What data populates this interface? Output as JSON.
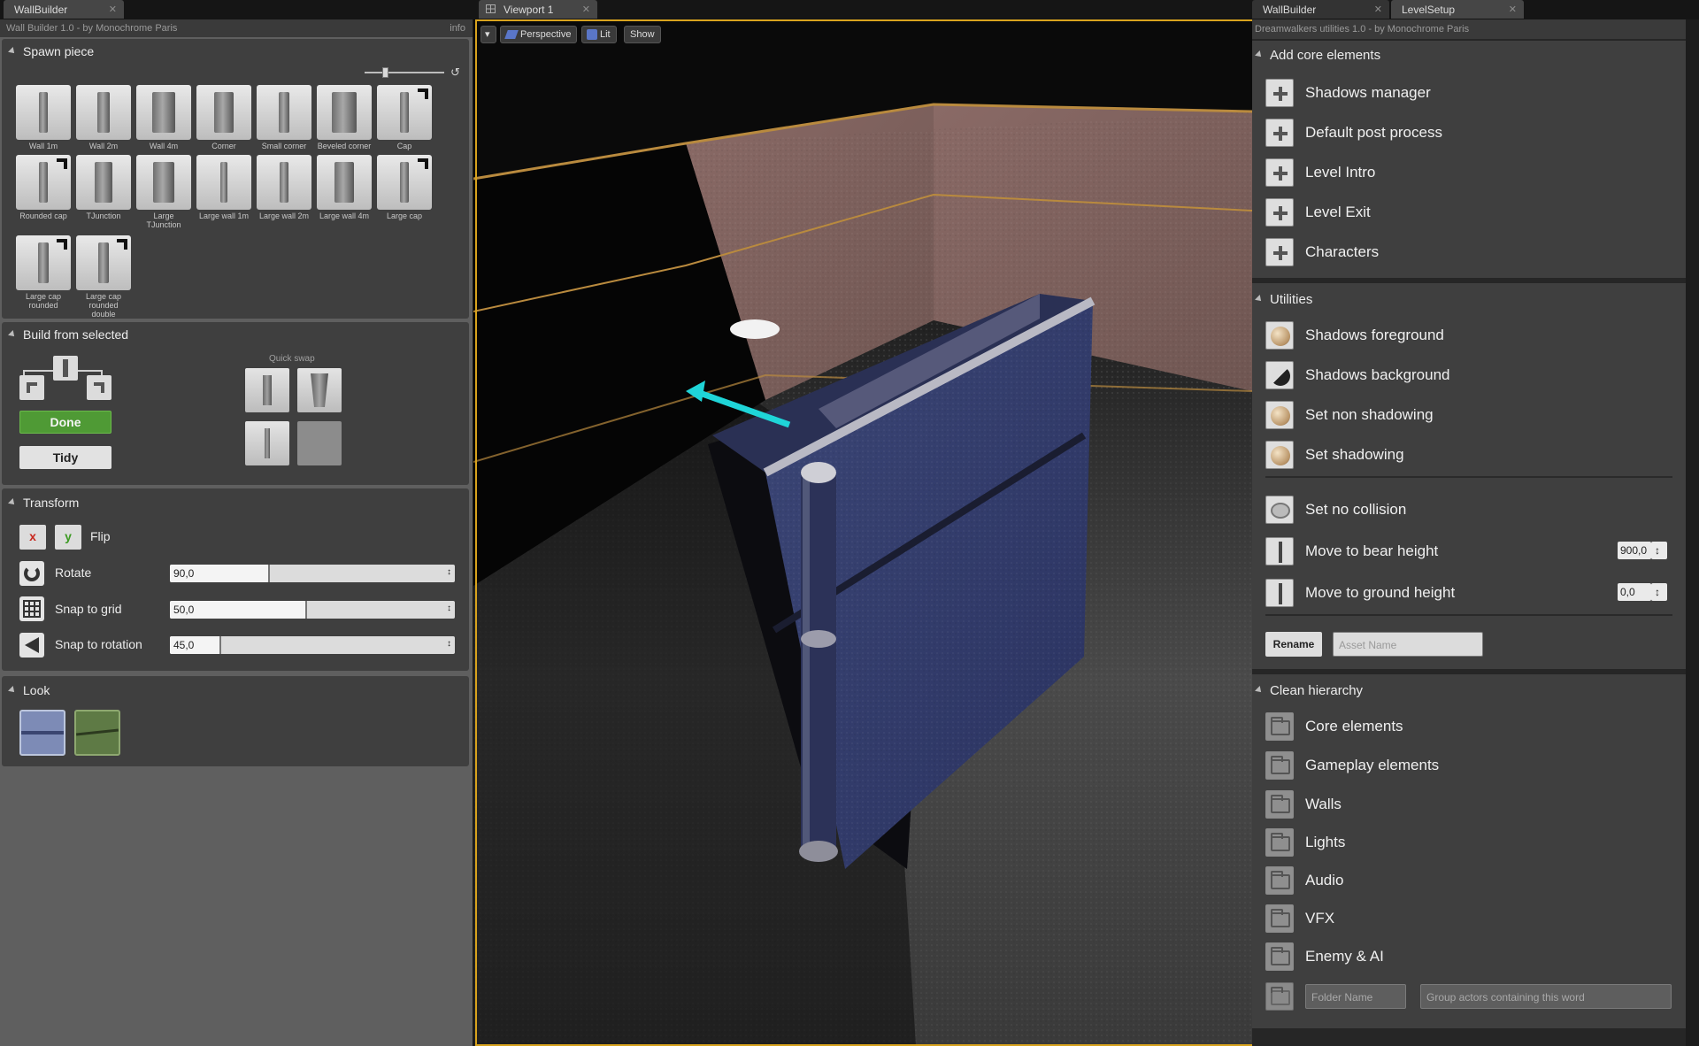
{
  "left_panel": {
    "tab": "WallBuilder",
    "subtitle": "Wall Builder 1.0 - by Monochrome Paris",
    "info": "info",
    "spawn": {
      "title": "Spawn piece",
      "pieces": [
        "Wall 1m",
        "Wall 2m",
        "Wall 4m",
        "Corner",
        "Small corner",
        "Beveled corner",
        "Cap",
        "Rounded cap",
        "TJunction",
        "Large TJunction",
        "Large wall 1m",
        "Large wall 2m",
        "Large wall 4m",
        "Large cap",
        "Large cap rounded",
        "Large cap rounded double"
      ]
    },
    "build": {
      "title": "Build from selected",
      "quick_swap": "Quick swap",
      "done": "Done",
      "tidy": "Tidy"
    },
    "transform": {
      "title": "Transform",
      "x": "x",
      "y": "y",
      "flip": "Flip",
      "rotate": "Rotate",
      "rotate_value": "90,0",
      "rotate_fraction": 0.35,
      "snap_grid": "Snap to grid",
      "snap_grid_value": "50,0",
      "snap_grid_fraction": 0.48,
      "snap_rotation": "Snap to rotation",
      "snap_rotation_value": "45,0",
      "snap_rotation_fraction": 0.18
    },
    "look": {
      "title": "Look"
    }
  },
  "viewport": {
    "tab": "Viewport 1",
    "perspective": "Perspective",
    "lit": "Lit",
    "show": "Show"
  },
  "right_panel": {
    "tabs": [
      "WallBuilder",
      "LevelSetup"
    ],
    "subtitle": "Dreamwalkers utilities 1.0 - by Monochrome Paris",
    "core": {
      "title": "Add core elements",
      "items": [
        "Shadows manager",
        "Default post process",
        "Level Intro",
        "Level Exit",
        "Characters"
      ]
    },
    "utilities": {
      "title": "Utilities",
      "items": [
        "Shadows foreground",
        "Shadows background",
        "Set non shadowing",
        "Set shadowing",
        "Set no collision",
        "Move to bear height",
        "Move to ground height"
      ],
      "bear_height": "900,0",
      "ground_height": "0,0",
      "rename": "Rename",
      "asset_placeholder": "Asset Name"
    },
    "clean": {
      "title": "Clean hierarchy",
      "items": [
        "Core elements",
        "Gameplay elements",
        "Walls",
        "Lights",
        "Audio",
        "VFX",
        "Enemy & AI"
      ],
      "folder_placeholder": "Folder Name",
      "group_placeholder": "Group actors containing this word"
    }
  },
  "colors": {
    "accent_border": "#d8a31e",
    "done_green": "#4f9a35",
    "gizmo_cyan": "#1fd5d8"
  }
}
